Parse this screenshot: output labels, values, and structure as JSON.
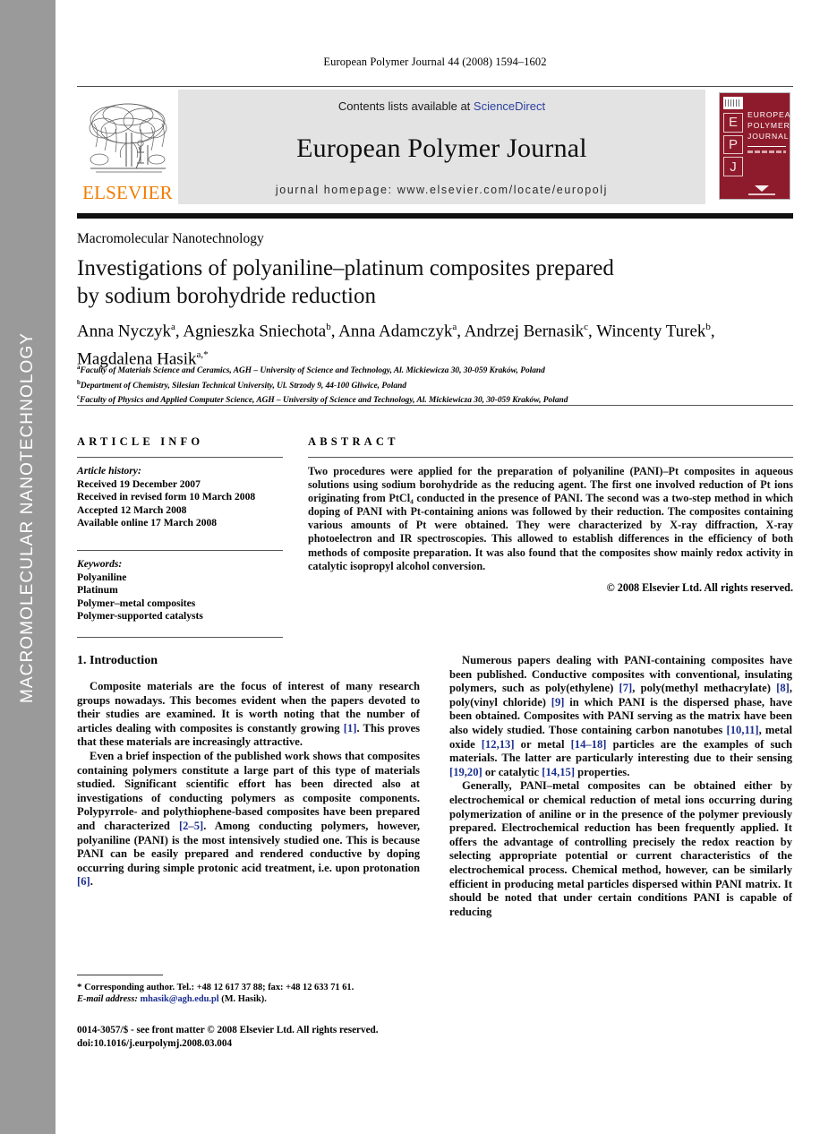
{
  "side_band": {
    "label": "MACROMOLECULAR NANOTECHNOLOGY",
    "color": "#9a9a9a"
  },
  "running_head": "European Polymer Journal 44 (2008) 1594–1602",
  "masthead": {
    "publisher_wordmark": "ELSEVIER",
    "contents_prefix": "Contents lists available at ",
    "contents_link": "ScienceDirect",
    "journal_title": "European Polymer Journal",
    "homepage": "journal homepage: www.elsevier.com/locate/europolj",
    "cover": {
      "letters": [
        "E",
        "P",
        "J"
      ],
      "title_lines": [
        "EUROPEAN",
        "POLYMER",
        "JOURNAL"
      ],
      "background_color": "#8e1b2b"
    },
    "sciencedirect_color": "#2b3f9e",
    "elsevier_orange": "#F07D00"
  },
  "kicker": "Macromolecular Nanotechnology",
  "title": {
    "line1": "Investigations of polyaniline–platinum composites prepared",
    "line2": "by sodium borohydride reduction"
  },
  "authors": {
    "line1_parts": [
      {
        "name": "Anna Nyczyk",
        "sup": "a"
      },
      {
        "name": "Agnieszka Sniechota",
        "sup": "b"
      },
      {
        "name": "Anna Adamczyk",
        "sup": "a"
      },
      {
        "name": "Andrzej Bernasik",
        "sup": "c"
      },
      {
        "name": "Wincenty Turek",
        "sup": "b"
      }
    ],
    "line2_parts": [
      {
        "name": "Magdalena Hasik",
        "sup": "a,*"
      }
    ]
  },
  "affiliations": [
    {
      "sup": "a",
      "text": "Faculty of Materials Science and Ceramics, AGH – University of Science and Technology, Al. Mickiewicza 30, 30-059 Kraków, Poland"
    },
    {
      "sup": "b",
      "text": "Department of Chemistry, Silesian Technical University, Ul. Strzody 9, 44-100 Gliwice, Poland"
    },
    {
      "sup": "c",
      "text": "Faculty of Physics and Applied Computer Science, AGH – University of Science and Technology, Al. Mickiewicza 30, 30-059 Kraków, Poland"
    }
  ],
  "article_info": {
    "heading": "ARTICLE INFO",
    "history_label": "Article history:",
    "history": [
      "Received 19 December 2007",
      "Received in revised form 10 March 2008",
      "Accepted 12 March 2008",
      "Available online 17 March 2008"
    ],
    "keywords_label": "Keywords:",
    "keywords": [
      "Polyaniline",
      "Platinum",
      "Polymer–metal composites",
      "Polymer-supported catalysts"
    ]
  },
  "abstract": {
    "heading": "ABSTRACT",
    "text": "Two procedures were applied for the preparation of polyaniline (PANI)–Pt composites in aqueous solutions using sodium borohydride as the reducing agent. The first one involved reduction of Pt ions originating from PtCl₄ conducted in the presence of PANI. The second was a two-step method in which doping of PANI with Pt-containing anions was followed by their reduction. The composites containing various amounts of Pt were obtained. They were characterized by X-ray diffraction, X-ray photoelectron and IR spectroscopies. This allowed to establish differences in the efficiency of both methods of composite preparation. It was also found that the composites show mainly redox activity in catalytic isopropyl alcohol conversion.",
    "copyright": "© 2008 Elsevier Ltd. All rights reserved."
  },
  "body": {
    "section_heading": "1. Introduction",
    "left_paragraphs": [
      "Composite materials are the focus of interest of many research groups nowadays. This becomes evident when the papers devoted to their studies are examined. It is worth noting that the number of articles dealing with composites is constantly growing [1]. This proves that these materials are increasingly attractive.",
      "Even a brief inspection of the published work shows that composites containing polymers constitute a large part of this type of materials studied. Significant scientific effort has been directed also at investigations of conducting polymers as composite components. Polypyrrole- and polythiophene-based composites have been prepared and characterized [2–5]. Among conducting polymers, however, polyaniline (PANI) is the most intensively studied one. This is because PANI can be easily prepared and rendered conductive by doping occurring during simple protonic acid treatment, i.e. upon protonation [6]."
    ],
    "right_paragraphs": [
      "Numerous papers dealing with PANI-containing composites have been published. Conductive composites with conventional, insulating polymers, such as poly(ethylene) [7], poly(methyl methacrylate) [8], poly(vinyl chloride) [9] in which PANI is the dispersed phase, have been obtained. Composites with PANI serving as the matrix have been also widely studied. Those containing carbon nanotubes [10,11], metal oxide [12,13] or metal [14–18] particles are the examples of such materials. The latter are particularly interesting due to their sensing [19,20] or catalytic [14,15] properties.",
      "Generally, PANI–metal composites can be obtained either by electrochemical or chemical reduction of metal ions occurring during polymerization of aniline or in the presence of the polymer previously prepared. Electrochemical reduction has been frequently applied. It offers the advantage of controlling precisely the redox reaction by selecting appropriate potential or current characteristics of the electrochemical process. Chemical method, however, can be similarly efficient in producing metal particles dispersed within PANI matrix. It should be noted that under certain conditions PANI is capable of reducing"
    ]
  },
  "footnote": {
    "marker": "*",
    "corresponding": "Corresponding author. Tel.: +48 12 617 37 88; fax: +48 12 633 71 61.",
    "email_label": "E-mail address:",
    "email": "mhasik@agh.edu.pl",
    "email_owner": "(M. Hasik).",
    "link_color": "#1c2f8f"
  },
  "imprint": {
    "line1": "0014-3057/$ - see front matter © 2008 Elsevier Ltd. All rights reserved.",
    "line2": "doi:10.1016/j.eurpolymj.2008.03.004"
  }
}
